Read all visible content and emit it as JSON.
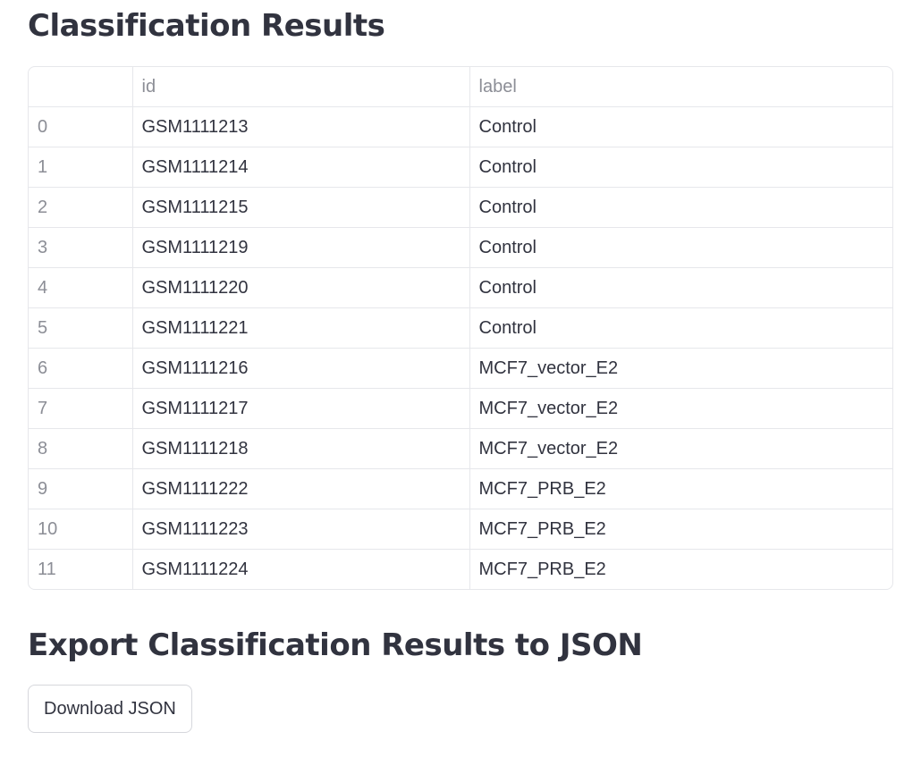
{
  "results": {
    "title": "Classification Results",
    "columns": [
      "",
      "id",
      "label"
    ],
    "rows": [
      {
        "index": "0",
        "id": "GSM1111213",
        "label": "Control"
      },
      {
        "index": "1",
        "id": "GSM1111214",
        "label": "Control"
      },
      {
        "index": "2",
        "id": "GSM1111215",
        "label": "Control"
      },
      {
        "index": "3",
        "id": "GSM1111219",
        "label": "Control"
      },
      {
        "index": "4",
        "id": "GSM1111220",
        "label": "Control"
      },
      {
        "index": "5",
        "id": "GSM1111221",
        "label": "Control"
      },
      {
        "index": "6",
        "id": "GSM1111216",
        "label": "MCF7_vector_E2"
      },
      {
        "index": "7",
        "id": "GSM1111217",
        "label": "MCF7_vector_E2"
      },
      {
        "index": "8",
        "id": "GSM1111218",
        "label": "MCF7_vector_E2"
      },
      {
        "index": "9",
        "id": "GSM1111222",
        "label": "MCF7_PRB_E2"
      },
      {
        "index": "10",
        "id": "GSM1111223",
        "label": "MCF7_PRB_E2"
      },
      {
        "index": "11",
        "id": "GSM1111224",
        "label": "MCF7_PRB_E2"
      }
    ]
  },
  "export": {
    "title": "Export Classification Results to JSON",
    "download_label": "Download JSON"
  },
  "colors": {
    "text": "#31333f",
    "muted": "#8c8e96",
    "border": "#e6e7eb"
  }
}
